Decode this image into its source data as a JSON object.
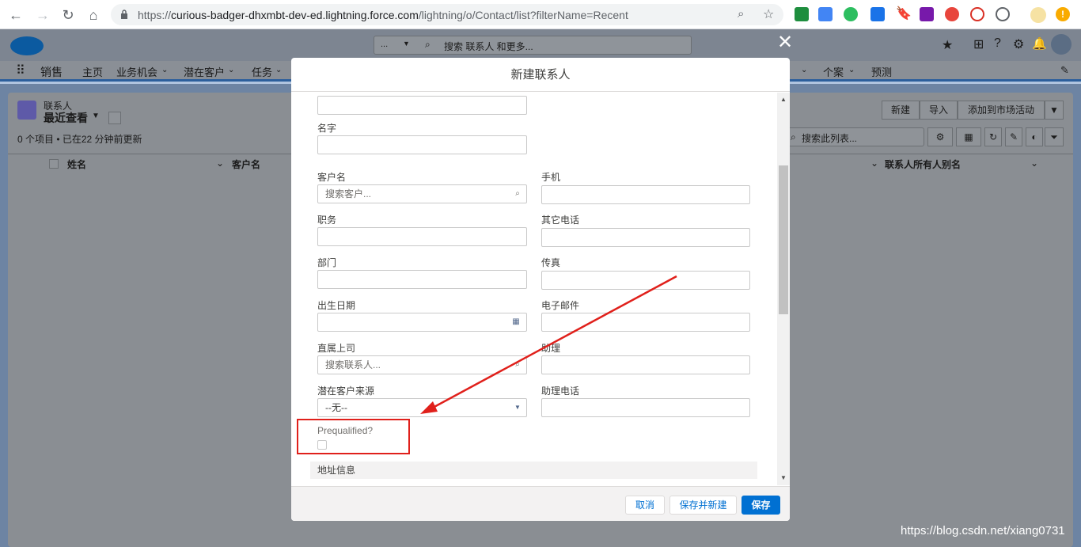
{
  "browser": {
    "url_prefix": "https://",
    "url_host": "curious-badger-dhxmbt-dev-ed.lightning.force.com",
    "url_path": "/lightning/o/Contact/list?filterName=Recent"
  },
  "sf": {
    "search_scope": "...",
    "search_placeholder": "搜索 联系人 和更多...",
    "app_name": "销售",
    "nav_items": [
      "主页",
      "业务机会",
      "潜在客户",
      "任务"
    ],
    "nav_items_right": [
      "个案",
      "预测"
    ],
    "object_label": "联系人",
    "list_view_name": "最近查看",
    "list_status": "0 个项目 • 已在22 分钟前更新",
    "buttons": {
      "new": "新建",
      "import": "导入",
      "add_campaign": "添加到市场活动"
    },
    "list_search_placeholder": "搜索此列表...",
    "columns": {
      "name": "姓名",
      "account": "客户名",
      "owner_alias": "联系人所有人别名"
    }
  },
  "modal": {
    "title": "新建联系人",
    "fields": {
      "first_name_label": "名字",
      "account_label": "客户名",
      "account_placeholder": "搜索客户...",
      "mobile_label": "手机",
      "title_label": "职务",
      "other_phone_label": "其它电话",
      "department_label": "部门",
      "fax_label": "传真",
      "birthdate_label": "出生日期",
      "email_label": "电子邮件",
      "reports_to_label": "直属上司",
      "reports_to_placeholder": "搜索联系人...",
      "assistant_label": "助理",
      "lead_source_label": "潜在客户来源",
      "lead_source_value": "--无--",
      "assistant_phone_label": "助理电话",
      "prequalified_label": "Prequalified?"
    },
    "section_address": "地址信息",
    "buttons": {
      "cancel": "取消",
      "save_new": "保存并新建",
      "save": "保存"
    }
  },
  "watermark": "https://blog.csdn.net/xiang0731",
  "colors": {
    "brand": "#0070d2",
    "annotation": "#e0201b"
  }
}
